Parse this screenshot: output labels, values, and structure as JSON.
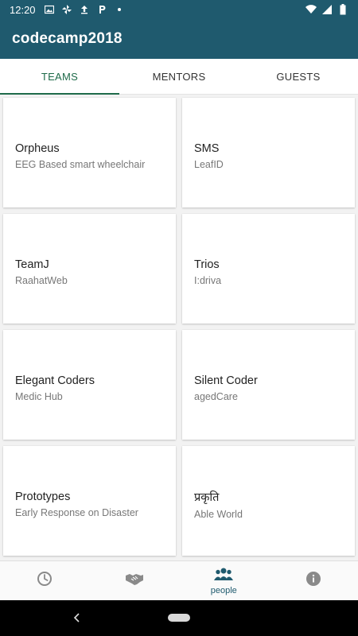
{
  "status_bar": {
    "time": "12:20",
    "icons": [
      "image-icon",
      "pinwheel-icon",
      "upload-icon",
      "p-icon",
      "dot-icon"
    ],
    "right_icons": [
      "wifi-icon",
      "signal-icon",
      "battery-icon"
    ]
  },
  "app_bar": {
    "title": "codecamp2018"
  },
  "tabs": [
    {
      "label": "TEAMS",
      "active": true
    },
    {
      "label": "MENTORS",
      "active": false
    },
    {
      "label": "GUESTS",
      "active": false
    }
  ],
  "cards": [
    {
      "title": "Orpheus",
      "subtitle": "EEG Based smart wheelchair"
    },
    {
      "title": "SMS",
      "subtitle": "LeafID"
    },
    {
      "title": "TeamJ",
      "subtitle": "RaahatWeb"
    },
    {
      "title": "Trios",
      "subtitle": "I:driva"
    },
    {
      "title": "Elegant Coders",
      "subtitle": "Medic Hub"
    },
    {
      "title": "Silent Coder",
      "subtitle": "agedCare"
    },
    {
      "title": "Prototypes",
      "subtitle": "Early Response on Disaster"
    },
    {
      "title": "प्रकृति",
      "subtitle": "Able World"
    }
  ],
  "bottom_nav": [
    {
      "icon": "clock-icon",
      "label": ""
    },
    {
      "icon": "handshake-icon",
      "label": ""
    },
    {
      "icon": "people-icon",
      "label": "people",
      "active": true
    },
    {
      "icon": "info-icon",
      "label": ""
    }
  ],
  "colors": {
    "primary": "#1f5a6e",
    "tab_accent": "#1f6b4a"
  }
}
